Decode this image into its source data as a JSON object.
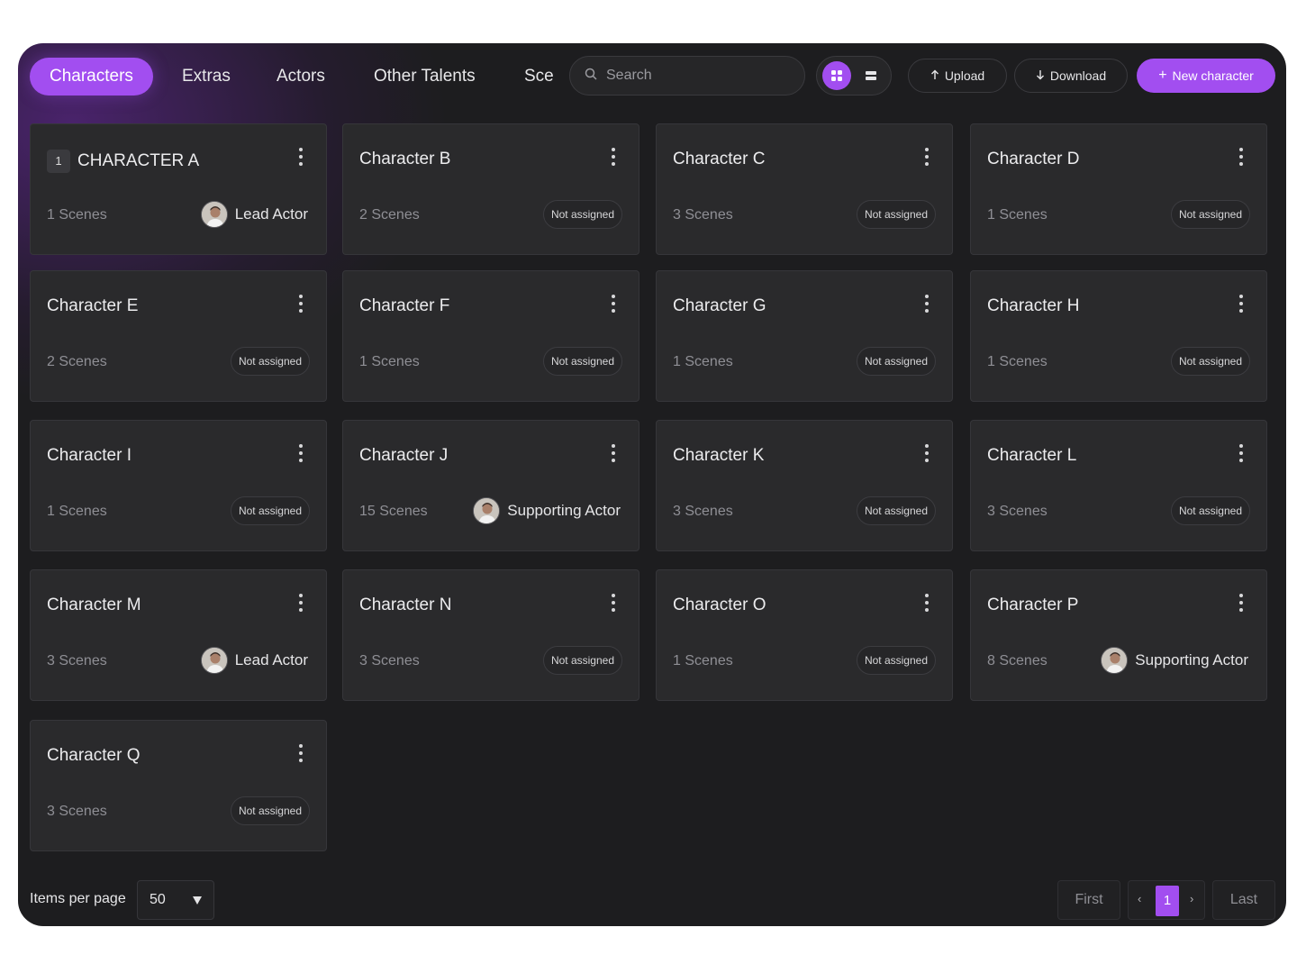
{
  "tabs": [
    {
      "label": "Characters",
      "active": true
    },
    {
      "label": "Extras"
    },
    {
      "label": "Actors"
    },
    {
      "label": "Other Talents"
    },
    {
      "label": "Sce"
    }
  ],
  "search": {
    "placeholder": "Search",
    "icon": "search-icon"
  },
  "view_toggle": {
    "grid_icon": "grid-view-icon",
    "list_icon": "list-view-icon",
    "selected": "grid"
  },
  "toolbar": {
    "upload_label": "Upload",
    "download_label": "Download",
    "new_label": "New character"
  },
  "accent_color": "#a24ef0",
  "cards": [
    {
      "badge": "1",
      "title": "CHARACTER A",
      "scenes": "1 Scenes",
      "status": "Lead Actor",
      "assigned": true
    },
    {
      "title": "Character B",
      "scenes": "2 Scenes",
      "status": "Not assigned",
      "assigned": false
    },
    {
      "title": "Character C",
      "scenes": "3 Scenes",
      "status": "Not assigned",
      "assigned": false
    },
    {
      "title": "Character D",
      "scenes": "1 Scenes",
      "status": "Not assigned",
      "assigned": false
    },
    {
      "title": "Character E",
      "scenes": "2 Scenes",
      "status": "Not assigned",
      "assigned": false
    },
    {
      "title": "Character F",
      "scenes": "1 Scenes",
      "status": "Not assigned",
      "assigned": false
    },
    {
      "title": "Character G",
      "scenes": "1 Scenes",
      "status": "Not assigned",
      "assigned": false
    },
    {
      "title": "Character H",
      "scenes": "1 Scenes",
      "status": "Not assigned",
      "assigned": false
    },
    {
      "title": "Character I",
      "scenes": "1 Scenes",
      "status": "Not assigned",
      "assigned": false
    },
    {
      "title": "Character J",
      "scenes": "15 Scenes",
      "status": "Supporting Actor",
      "assigned": true
    },
    {
      "title": "Character K",
      "scenes": "3 Scenes",
      "status": "Not assigned",
      "assigned": false
    },
    {
      "title": "Character L",
      "scenes": "3 Scenes",
      "status": "Not assigned",
      "assigned": false
    },
    {
      "title": "Character M",
      "scenes": "3 Scenes",
      "status": "Lead Actor",
      "assigned": true
    },
    {
      "title": "Character N",
      "scenes": "3 Scenes",
      "status": "Not assigned",
      "assigned": false
    },
    {
      "title": "Character O",
      "scenes": "1 Scenes",
      "status": "Not assigned",
      "assigned": false
    },
    {
      "title": "Character P",
      "scenes": "8 Scenes",
      "status": "Supporting Actor",
      "assigned": true
    },
    {
      "title": "Character Q",
      "scenes": "3 Scenes",
      "status": "Not assigned",
      "assigned": false
    }
  ],
  "footer": {
    "items_per_page_label": "Items per page",
    "items_per_page_value": "50",
    "first_label": "First",
    "prev_label": "‹",
    "current_page": "1",
    "next_label": "›",
    "last_label": "Last"
  }
}
